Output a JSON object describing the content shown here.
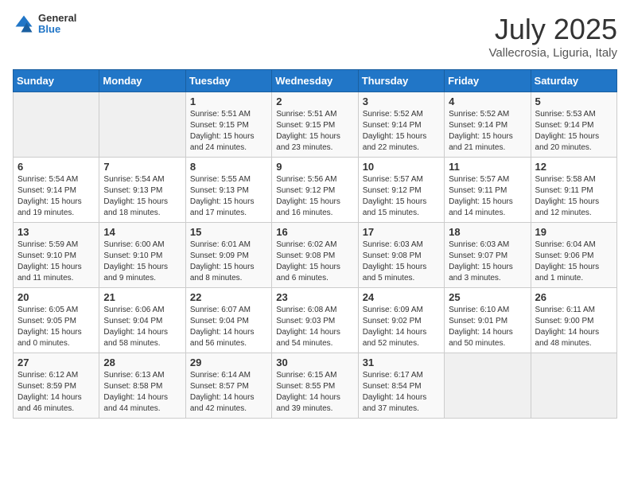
{
  "header": {
    "logo_general": "General",
    "logo_blue": "Blue",
    "month_title": "July 2025",
    "location": "Vallecrosia, Liguria, Italy"
  },
  "days_of_week": [
    "Sunday",
    "Monday",
    "Tuesday",
    "Wednesday",
    "Thursday",
    "Friday",
    "Saturday"
  ],
  "weeks": [
    [
      {
        "day": "",
        "sunrise": "",
        "sunset": "",
        "daylight": "",
        "empty": true
      },
      {
        "day": "",
        "sunrise": "",
        "sunset": "",
        "daylight": "",
        "empty": true
      },
      {
        "day": "1",
        "sunrise": "Sunrise: 5:51 AM",
        "sunset": "Sunset: 9:15 PM",
        "daylight": "Daylight: 15 hours and 24 minutes."
      },
      {
        "day": "2",
        "sunrise": "Sunrise: 5:51 AM",
        "sunset": "Sunset: 9:15 PM",
        "daylight": "Daylight: 15 hours and 23 minutes."
      },
      {
        "day": "3",
        "sunrise": "Sunrise: 5:52 AM",
        "sunset": "Sunset: 9:14 PM",
        "daylight": "Daylight: 15 hours and 22 minutes."
      },
      {
        "day": "4",
        "sunrise": "Sunrise: 5:52 AM",
        "sunset": "Sunset: 9:14 PM",
        "daylight": "Daylight: 15 hours and 21 minutes."
      },
      {
        "day": "5",
        "sunrise": "Sunrise: 5:53 AM",
        "sunset": "Sunset: 9:14 PM",
        "daylight": "Daylight: 15 hours and 20 minutes."
      }
    ],
    [
      {
        "day": "6",
        "sunrise": "Sunrise: 5:54 AM",
        "sunset": "Sunset: 9:14 PM",
        "daylight": "Daylight: 15 hours and 19 minutes."
      },
      {
        "day": "7",
        "sunrise": "Sunrise: 5:54 AM",
        "sunset": "Sunset: 9:13 PM",
        "daylight": "Daylight: 15 hours and 18 minutes."
      },
      {
        "day": "8",
        "sunrise": "Sunrise: 5:55 AM",
        "sunset": "Sunset: 9:13 PM",
        "daylight": "Daylight: 15 hours and 17 minutes."
      },
      {
        "day": "9",
        "sunrise": "Sunrise: 5:56 AM",
        "sunset": "Sunset: 9:12 PM",
        "daylight": "Daylight: 15 hours and 16 minutes."
      },
      {
        "day": "10",
        "sunrise": "Sunrise: 5:57 AM",
        "sunset": "Sunset: 9:12 PM",
        "daylight": "Daylight: 15 hours and 15 minutes."
      },
      {
        "day": "11",
        "sunrise": "Sunrise: 5:57 AM",
        "sunset": "Sunset: 9:11 PM",
        "daylight": "Daylight: 15 hours and 14 minutes."
      },
      {
        "day": "12",
        "sunrise": "Sunrise: 5:58 AM",
        "sunset": "Sunset: 9:11 PM",
        "daylight": "Daylight: 15 hours and 12 minutes."
      }
    ],
    [
      {
        "day": "13",
        "sunrise": "Sunrise: 5:59 AM",
        "sunset": "Sunset: 9:10 PM",
        "daylight": "Daylight: 15 hours and 11 minutes."
      },
      {
        "day": "14",
        "sunrise": "Sunrise: 6:00 AM",
        "sunset": "Sunset: 9:10 PM",
        "daylight": "Daylight: 15 hours and 9 minutes."
      },
      {
        "day": "15",
        "sunrise": "Sunrise: 6:01 AM",
        "sunset": "Sunset: 9:09 PM",
        "daylight": "Daylight: 15 hours and 8 minutes."
      },
      {
        "day": "16",
        "sunrise": "Sunrise: 6:02 AM",
        "sunset": "Sunset: 9:08 PM",
        "daylight": "Daylight: 15 hours and 6 minutes."
      },
      {
        "day": "17",
        "sunrise": "Sunrise: 6:03 AM",
        "sunset": "Sunset: 9:08 PM",
        "daylight": "Daylight: 15 hours and 5 minutes."
      },
      {
        "day": "18",
        "sunrise": "Sunrise: 6:03 AM",
        "sunset": "Sunset: 9:07 PM",
        "daylight": "Daylight: 15 hours and 3 minutes."
      },
      {
        "day": "19",
        "sunrise": "Sunrise: 6:04 AM",
        "sunset": "Sunset: 9:06 PM",
        "daylight": "Daylight: 15 hours and 1 minute."
      }
    ],
    [
      {
        "day": "20",
        "sunrise": "Sunrise: 6:05 AM",
        "sunset": "Sunset: 9:05 PM",
        "daylight": "Daylight: 15 hours and 0 minutes."
      },
      {
        "day": "21",
        "sunrise": "Sunrise: 6:06 AM",
        "sunset": "Sunset: 9:04 PM",
        "daylight": "Daylight: 14 hours and 58 minutes."
      },
      {
        "day": "22",
        "sunrise": "Sunrise: 6:07 AM",
        "sunset": "Sunset: 9:04 PM",
        "daylight": "Daylight: 14 hours and 56 minutes."
      },
      {
        "day": "23",
        "sunrise": "Sunrise: 6:08 AM",
        "sunset": "Sunset: 9:03 PM",
        "daylight": "Daylight: 14 hours and 54 minutes."
      },
      {
        "day": "24",
        "sunrise": "Sunrise: 6:09 AM",
        "sunset": "Sunset: 9:02 PM",
        "daylight": "Daylight: 14 hours and 52 minutes."
      },
      {
        "day": "25",
        "sunrise": "Sunrise: 6:10 AM",
        "sunset": "Sunset: 9:01 PM",
        "daylight": "Daylight: 14 hours and 50 minutes."
      },
      {
        "day": "26",
        "sunrise": "Sunrise: 6:11 AM",
        "sunset": "Sunset: 9:00 PM",
        "daylight": "Daylight: 14 hours and 48 minutes."
      }
    ],
    [
      {
        "day": "27",
        "sunrise": "Sunrise: 6:12 AM",
        "sunset": "Sunset: 8:59 PM",
        "daylight": "Daylight: 14 hours and 46 minutes."
      },
      {
        "day": "28",
        "sunrise": "Sunrise: 6:13 AM",
        "sunset": "Sunset: 8:58 PM",
        "daylight": "Daylight: 14 hours and 44 minutes."
      },
      {
        "day": "29",
        "sunrise": "Sunrise: 6:14 AM",
        "sunset": "Sunset: 8:57 PM",
        "daylight": "Daylight: 14 hours and 42 minutes."
      },
      {
        "day": "30",
        "sunrise": "Sunrise: 6:15 AM",
        "sunset": "Sunset: 8:55 PM",
        "daylight": "Daylight: 14 hours and 39 minutes."
      },
      {
        "day": "31",
        "sunrise": "Sunrise: 6:17 AM",
        "sunset": "Sunset: 8:54 PM",
        "daylight": "Daylight: 14 hours and 37 minutes."
      },
      {
        "day": "",
        "sunrise": "",
        "sunset": "",
        "daylight": "",
        "empty": true
      },
      {
        "day": "",
        "sunrise": "",
        "sunset": "",
        "daylight": "",
        "empty": true
      }
    ]
  ]
}
